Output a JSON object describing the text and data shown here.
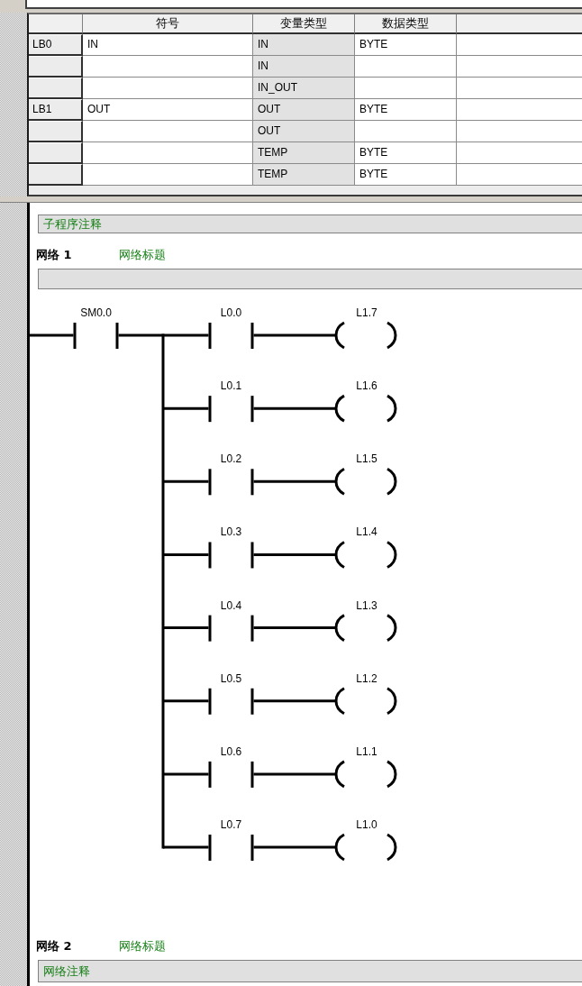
{
  "variable_table": {
    "columns": [
      "符号",
      "变量类型",
      "数据类型"
    ],
    "rows": [
      {
        "address": "LB0",
        "symbol": "IN",
        "var_type": "IN",
        "data_type": "BYTE"
      },
      {
        "var_type": "IN"
      },
      {
        "var_type": "IN_OUT"
      },
      {
        "address": "LB1",
        "symbol": "OUT",
        "var_type": "OUT",
        "data_type": "BYTE"
      },
      {
        "var_type": "OUT"
      },
      {
        "var_type": "TEMP",
        "data_type": "BYTE"
      },
      {
        "var_type": "TEMP",
        "data_type": "BYTE"
      }
    ]
  },
  "program": {
    "comment": "子程序注释",
    "networks": [
      {
        "label": "网络 1",
        "title": "网络标题",
        "ladder": {
          "input": "SM0.0",
          "branches": [
            {
              "contact": "L0.0",
              "coil": "L1.7"
            },
            {
              "contact": "L0.1",
              "coil": "L1.6"
            },
            {
              "contact": "L0.2",
              "coil": "L1.5"
            },
            {
              "contact": "L0.3",
              "coil": "L1.4"
            },
            {
              "contact": "L0.4",
              "coil": "L1.3"
            },
            {
              "contact": "L0.5",
              "coil": "L1.2"
            },
            {
              "contact": "L0.6",
              "coil": "L1.1"
            },
            {
              "contact": "L0.7",
              "coil": "L1.0"
            }
          ]
        }
      },
      {
        "label": "网络 2",
        "title": "网络标题",
        "comment": "网络注释"
      }
    ]
  }
}
